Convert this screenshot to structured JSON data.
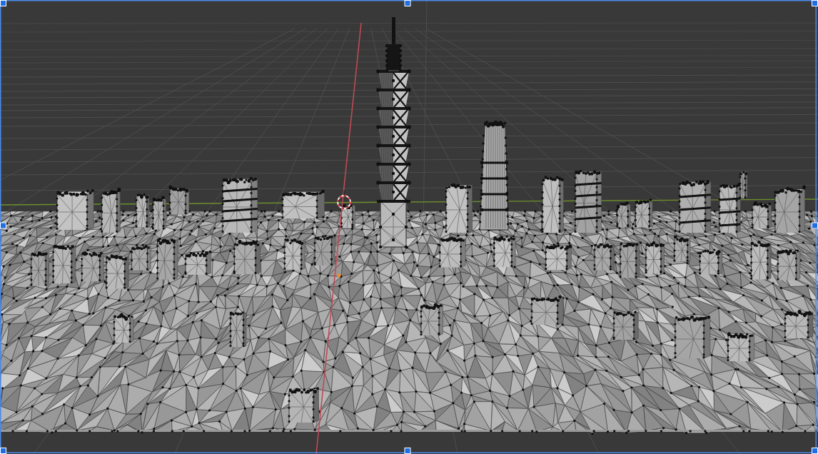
{
  "frame": {
    "selected": true
  }
}
